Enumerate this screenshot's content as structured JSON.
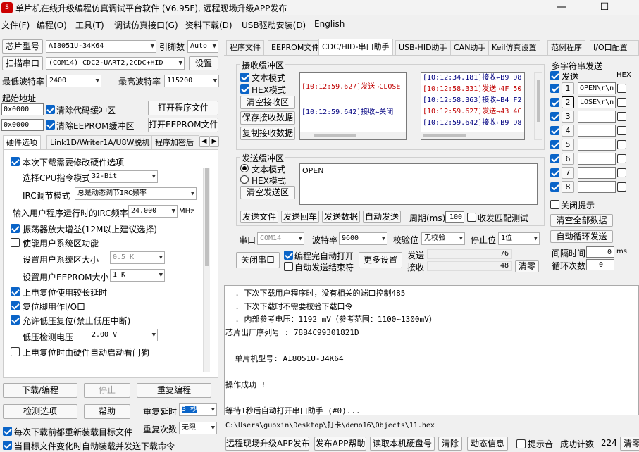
{
  "window": {
    "title": "单片机在线升级编程仿真调试平台软件 (V6.95F), 远程现场升级APP发布",
    "minimize": "—",
    "maximize": "☐",
    "close": "✕"
  },
  "menu": [
    "文件(F)",
    "编程(O)",
    "工具(T)",
    "调试仿真接口(G)",
    "资料下载(D)",
    "USB驱动安装(D)",
    "English"
  ],
  "left": {
    "chip_label": "芯片型号",
    "chip_value": "AI8051U-34K64",
    "pins_label": "引脚数",
    "pins_value": "Auto",
    "scan_button": "扫描串口",
    "port_value": "(COM14) CDC2-UART2,2CDC+HID",
    "settings_button": "设置",
    "min_baud_label": "最低波特率",
    "min_baud_value": "2400",
    "max_baud_label": "最高波特率",
    "max_baud_value": "115200",
    "start_addr_label": "起始地址",
    "addr1": "0x0000",
    "clear_code_label": "清除代码缓冲区",
    "open_prog_button": "打开程序文件",
    "addr2": "0x0000",
    "clear_eeprom_label": "清除EEPROM缓冲区",
    "open_eeprom_button": "打开EEPROM文件",
    "tabs": [
      "硬件选项",
      "Link1D/Writer1A/U8W脱机",
      "程序加密后"
    ],
    "hw": {
      "opt_need_modify": "本次下载需要修改硬件选项",
      "cpu_mode_label": "选择CPU指令模式",
      "cpu_mode_value": "32-Bit",
      "irc_mode_label": "IRC调节模式",
      "irc_mode_value": "总是动态调节IRC频率",
      "irc_freq_label": "输入用户程序运行时的IRC频率",
      "irc_freq_value": "24.000",
      "irc_freq_unit": "MHz",
      "osc_gain": "振荡器放大增益(12M以上建议选择)",
      "user_sys_area": "使能用户系统区功能",
      "user_sys_size_label": "设置用户系统区大小",
      "user_sys_size_value": "0.5  K",
      "user_eeprom_size_label": "设置用户EEPROM大小",
      "user_eeprom_size_value": "1    K",
      "power_reset_long": "上电复位使用较长延时",
      "reset_pin_io": "复位脚用作I/O口",
      "low_voltage_reset": "允许低压复位(禁止低压中断)",
      "low_voltage_label": "低压检测电压",
      "low_voltage_value": "2.00 V",
      "power_watchdog": "上电复位时由硬件自动启动看门狗"
    },
    "download_button": "下载/编程",
    "stop_button": "停止",
    "reprogram_button": "重复编程",
    "check_options_button": "检测选项",
    "help_button": "帮助",
    "repeat_delay_label": "重复延时",
    "repeat_delay_value": "3 秒",
    "reload_each": "每次下载前都重新装载目标文件",
    "repeat_count_label": "重复次数",
    "repeat_count_value": "无限",
    "auto_load_partial": "当目标文件变化时自动装载并发送下载命令"
  },
  "right": {
    "tabs": [
      "程序文件",
      "EEPROM文件",
      "CDC/HID-串口助手",
      "USB-HID助手",
      "CAN助手",
      "Keil仿真设置",
      "范例程序",
      "I/O口配置"
    ],
    "recv": {
      "group_label": "接收缓冲区",
      "text_mode": "文本模式",
      "hex_mode": "HEX模式",
      "clear_button": "清空接收区",
      "save_button": "保存接收数据",
      "copy_button": "复制接收数据",
      "text_lines": [
        {
          "text": "                              ",
          "color": "blue"
        },
        {
          "text": "[10:12:59.627]发送→CLOSE",
          "color": "red"
        },
        {
          "text": "",
          "color": "blue"
        },
        {
          "text": "[10:12:59.642]接收←关闭",
          "color": "blue"
        }
      ],
      "hex_lines": [
        {
          "text": "[10:12:34.181]接收←B9 D8",
          "color": "blue"
        },
        {
          "text": "[10:12:58.331]发送→4F 50",
          "color": "red"
        },
        {
          "text": "[10:12:58.363]接收←B4 F2",
          "color": "blue"
        },
        {
          "text": "[10:12:59.627]发送→43 4C",
          "color": "red"
        },
        {
          "text": "[10:12:59.642]接收←B9 D8",
          "color": "blue"
        }
      ]
    },
    "send": {
      "group_label": "发送缓冲区",
      "text_mode": "文本模式",
      "hex_mode": "HEX模式",
      "clear_button": "清空发送区",
      "content": "OPEN",
      "send_file": "发送文件",
      "send_cr": "发送回车",
      "send_data": "发送数据",
      "auto_send": "自动发送",
      "period_label": "周期(ms)",
      "period_value": "100",
      "match_resp": "收发匹配测试"
    },
    "port": {
      "port_label": "串口",
      "port_value": "COM14",
      "baud_label": "波特率",
      "baud_value": "9600",
      "parity_label": "校验位",
      "parity_value": "无校验",
      "stop_label": "停止位",
      "stop_value": "1位",
      "close_button": "关闭串口",
      "open_after_prog": "编程完自动打开",
      "auto_send_end": "自动发送结束符",
      "more_button": "更多设置",
      "sent_label": "发送",
      "sent_value": "76",
      "recv_label": "接收",
      "recv_value": "48",
      "clear_button": "清零"
    },
    "multi": {
      "group_label": "多字符串发送",
      "send_header": "发送",
      "hex_header": "HEX",
      "items": [
        {
          "num": "1",
          "value": "OPEN\\r\\n"
        },
        {
          "num": "2",
          "value": "LOSE\\r\\n"
        },
        {
          "num": "3",
          "value": ""
        },
        {
          "num": "4",
          "value": ""
        },
        {
          "num": "5",
          "value": ""
        },
        {
          "num": "6",
          "value": ""
        },
        {
          "num": "7",
          "value": ""
        },
        {
          "num": "8",
          "value": ""
        }
      ],
      "close_prompt": "关闭提示",
      "clear_all": "清空全部数据",
      "auto_loop": "自动循环发送",
      "interval_label": "间隔时间",
      "interval_value": "0",
      "interval_unit": "ms",
      "loop_label": "循环次数",
      "loop_value": "0"
    },
    "log_lines": [
      "  . 下次下载用户程序时，没有相关的端口控制485",
      "  . 下次下载时不需要校验下载口令",
      "  . 内部参考电压：1192 mV（参考范围：1100~1300mV）",
      "芯片出厂序列号 : 78B4C99301821D",
      "",
      "  单片机型号: AI8051U-34K64",
      "",
      "操作成功 !",
      "",
      "等待1秒后自动打开串口助手 (#0)..."
    ],
    "file_path": "C:\\Users\\guoxin\\Desktop\\打卡\\demo16\\Objects\\11.hex",
    "bottom": {
      "publish_app": "远程现场升级APP发布",
      "publish_help": "发布APP帮助",
      "read_disk": "读取本机硬盘号",
      "clear": "清除",
      "animation": "动态信息",
      "beep": "提示音",
      "success_label": "成功计数",
      "success_value": "224",
      "clear2": "清零"
    }
  }
}
